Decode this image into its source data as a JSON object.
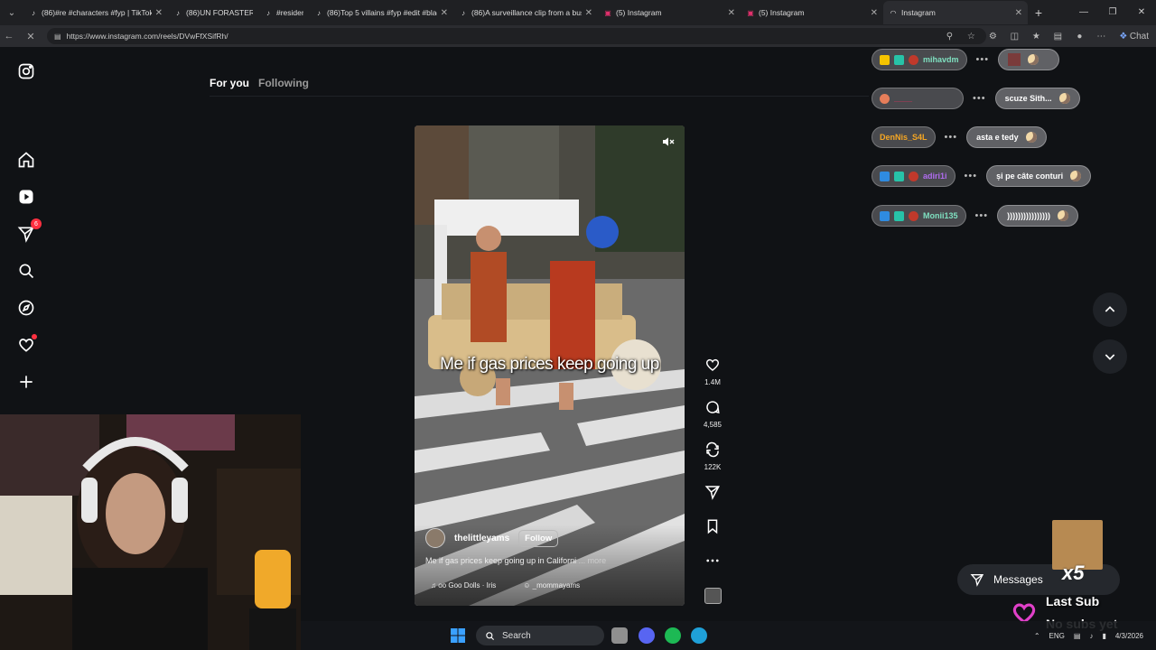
{
  "browser": {
    "tabs": [
      {
        "title": "(86)#re #characters #fyp | TikTok",
        "icon": "tiktok-icon"
      },
      {
        "title": "(86)UN FORASTERO",
        "icon": "tiktok-icon"
      },
      {
        "title": "#resident",
        "icon": "tiktok-icon"
      },
      {
        "title": "(86)Top 5 villains #fyp #edit #black",
        "icon": "tiktok-icon"
      },
      {
        "title": "(86)A surveillance clip from a busy",
        "icon": "tiktok-icon"
      },
      {
        "title": "(5) Instagram",
        "icon": "instagram-icon"
      },
      {
        "title": "(5) Instagram",
        "icon": "instagram-icon"
      },
      {
        "title": "Instagram",
        "icon": "loading-icon"
      }
    ],
    "url": "https://www.instagram.com/reels/DVwFfXSifRh/",
    "chat_label": "Chat"
  },
  "instagram": {
    "sidebar_badge": "6",
    "feed_tabs": {
      "for_you": "For you",
      "following": "Following"
    },
    "reel": {
      "overlay_text": "Me if gas prices keep going up",
      "username": "thelittleyams",
      "follow_label": "Follow",
      "description": "Me if gas prices keep going up in Californi",
      "more_label": "... more",
      "audio": "oo Goo Dolls · Iris",
      "collab": "_mommayams"
    },
    "actions": {
      "likes": "1.4M",
      "comments": "4,585",
      "reposts": "122K"
    },
    "messages_label": "Messages"
  },
  "stream_chat": [
    {
      "user": "mihavdm",
      "message": "",
      "user_color": "#7fe0c0"
    },
    {
      "user": "____",
      "message": "scuze Sith...",
      "user_color": "#e0305a"
    },
    {
      "user": "DenNis_S4L",
      "message": "asta e tedy",
      "user_color": "#f5a623"
    },
    {
      "user": "adiri1i",
      "message": "și pe câte conturi",
      "user_color": "#b06cf0"
    },
    {
      "user": "Monii135",
      "message": "))))))))))))))))",
      "user_color": "#7fe0c0"
    }
  ],
  "sub_widget": {
    "multiplier": "x5",
    "last_sub_label": "Last Sub",
    "no_subs_label": "No subs yet"
  },
  "taskbar": {
    "search_label": "Search",
    "lang": "ENG",
    "time": "",
    "date": "4/3/2026"
  }
}
